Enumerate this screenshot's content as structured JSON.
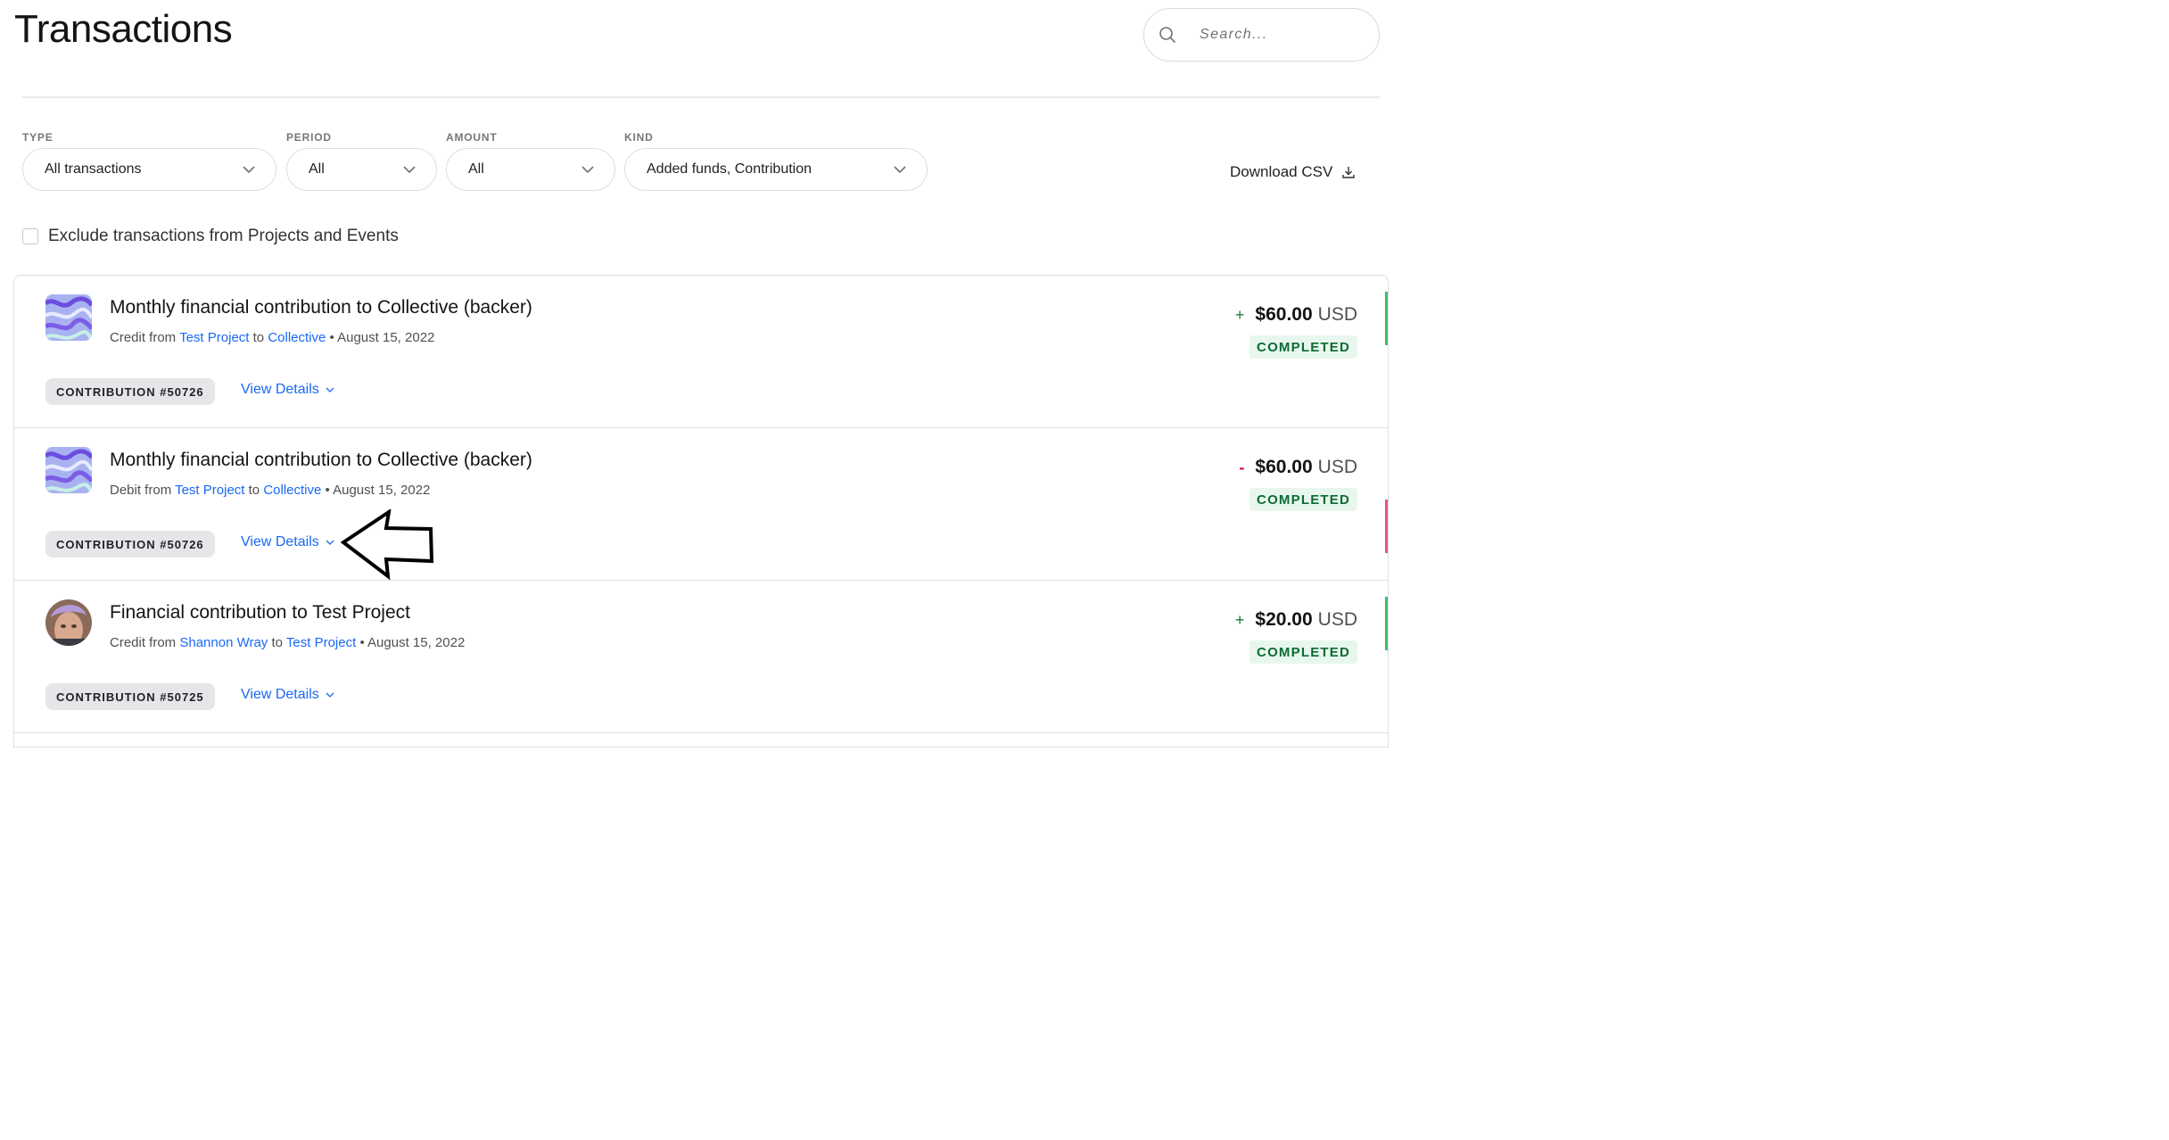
{
  "page": {
    "title": "Transactions"
  },
  "search": {
    "placeholder": "Search..."
  },
  "filters": [
    {
      "label": "TYPE",
      "value": "All transactions"
    },
    {
      "label": "PERIOD",
      "value": "All"
    },
    {
      "label": "AMOUNT",
      "value": "All"
    },
    {
      "label": "KIND",
      "value": "Added funds, Contribution"
    }
  ],
  "download": {
    "label": "Download CSV"
  },
  "exclude": {
    "label": "Exclude transactions from Projects and Events",
    "checked": false
  },
  "transactions": [
    {
      "title": "Monthly financial contribution to Collective (backer)",
      "kind": "Credit from",
      "from": "Test Project",
      "to_word": "to",
      "to": "Collective",
      "date": "• August 15, 2022",
      "sign": "+",
      "amount": "$60.00",
      "currency": "USD",
      "status": "COMPLETED",
      "badge": "CONTRIBUTION #50726",
      "view": "View Details",
      "accent": "#1f7a3c"
    },
    {
      "title": "Monthly financial contribution to Collective (backer)",
      "kind": "Debit from",
      "from": "Test Project",
      "to_word": "to",
      "to": "Collective",
      "date": "• August 15, 2022",
      "sign": "-",
      "amount": "$60.00",
      "currency": "USD",
      "status": "COMPLETED",
      "badge": "CONTRIBUTION #50726",
      "view": "View Details",
      "accent": "#c9183d"
    },
    {
      "title": "Financial contribution to Test Project",
      "kind": "Credit from",
      "from": "Shannon Wray",
      "to_word": "to",
      "to": "Test Project",
      "date": "• August 15, 2022",
      "sign": "+",
      "amount": "$20.00",
      "currency": "USD",
      "status": "COMPLETED",
      "badge": "CONTRIBUTION #50725",
      "view": "View Details",
      "accent": "#1f7a3c"
    }
  ],
  "colors": {
    "link": "#1869f5",
    "positive": "#1f7a3c",
    "negative": "#c9183d",
    "status_bg": "#e8f7ee",
    "status_text": "#0b6b33"
  }
}
